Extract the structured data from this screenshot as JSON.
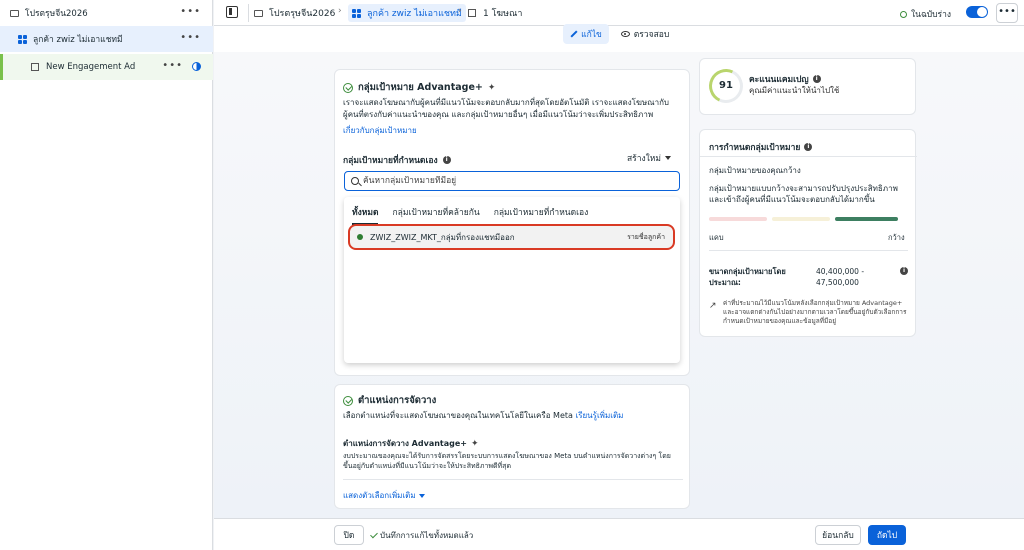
{
  "sidebar": {
    "campaign": {
      "label": "โปรตรุษจีน2026"
    },
    "adset": {
      "label": "ลูกค้า zwiz ไม่เอาแชทมี"
    },
    "ad": {
      "label": "New Engagement Ad"
    },
    "more_glyph": "•••"
  },
  "topbar": {
    "crumb_campaign": "โปรตรุษจีน2026",
    "crumb_adset": "ลูกค้า zwiz ไม่เอาแชทมี",
    "crumb_ad": "1 โฆษณา",
    "status": "ในฉบับร่าง",
    "more_glyph": "•••"
  },
  "tabs": {
    "edit": "แก้ไข",
    "review": "ตรวจสอบ"
  },
  "audience": {
    "title": "กลุ่มเป้าหมาย Advantage+",
    "desc": "เราจะแสดงโฆษณากับผู้คนที่มีแนวโน้มจะตอบกลับมากที่สุดโดยอัตโนมัติ เราจะแสดงโฆษณากับผู้คนที่ตรงกับค่าแนะนำของคุณ และกลุ่มเป้าหมายอื่นๆ เมื่อมีแนวโน้มว่าจะเพิ่มประสิทธิภาพ",
    "learn_link": "เกี่ยวกับกลุ่มเป้าหมาย",
    "custom_label": "กลุ่มเป้าหมายที่กำหนดเอง",
    "create_new": "สร้างใหม่",
    "search_placeholder": "ค้นหากลุ่มเป้าหมายที่มีอยู่",
    "dropdown_tabs": [
      "ทั้งหมด",
      "กลุ่มเป้าหมายที่คล้ายกัน",
      "กลุ่มเป้าหมายที่กำหนดเอง"
    ],
    "result": {
      "name": "ZWIZ_ZWIZ_MKT_กลุ่มที่กรองแชทมีออก",
      "type": "รายชื่อลูกค้า"
    }
  },
  "placement": {
    "title": "ตำแหน่งการจัดวาง",
    "desc": "เลือกตำแหน่งที่จะแสดงโฆษณาของคุณในเทคโนโลยีในเครือ Meta",
    "learn_link": "เรียนรู้เพิ่มเติม",
    "sub_title": "ตำแหน่งการจัดวาง Advantage+",
    "sub_text": "งบประมาณของคุณจะได้รับการจัดสรรโดยระบบการแสดงโฆษณาของ Meta บนตำแหน่งการจัดวางต่างๆ โดยขึ้นอยู่กับตำแหน่งที่มีแนวโน้มว่าจะให้ประสิทธิภาพดีที่สุด",
    "show_more": "แสดงตัวเลือกเพิ่มเติม"
  },
  "score": {
    "value": "91",
    "title": "คะแนนแคมเปญ",
    "sub": "คุณมีค่าแนะนำให้นำไปใช้"
  },
  "definition": {
    "title": "การกำหนดกลุ่มเป้าหมาย",
    "line1": "กลุ่มเป้าหมายของคุณกว้าง",
    "line2": "กลุ่มเป้าหมายแบบกว้างจะสามารถปรับปรุงประสิทธิภาพและเข้าถึงผู้คนที่มีแนวโน้มจะตอบกลับได้มากขึ้น",
    "left": "แคบ",
    "right": "กว้าง",
    "size_label": "ขนาดกลุ่มเป้าหมายโดยประมาณ:",
    "size_value": "40,400,000 - 47,500,000",
    "note": "ค่าที่ประมาณไว้มีแนวโน้มหลังเลือกกลุ่มเป้าหมาย Advantage+ และอาจแตกต่างกันไปอย่างมากตามเวลาโดยขึ้นอยู่กับตัวเลือกการกำหนดเป้าหมายของคุณและข้อมูลที่มีอยู่"
  },
  "bottom": {
    "close": "ปิด",
    "saved": "บันทึกการแก้ไขทั้งหมดแล้ว",
    "back": "ย้อนกลับ",
    "next": "ถัดไป"
  },
  "colors": {
    "accent": "#0a62d9",
    "highlight_border": "#d93a24",
    "success": "#3d8d3c"
  }
}
